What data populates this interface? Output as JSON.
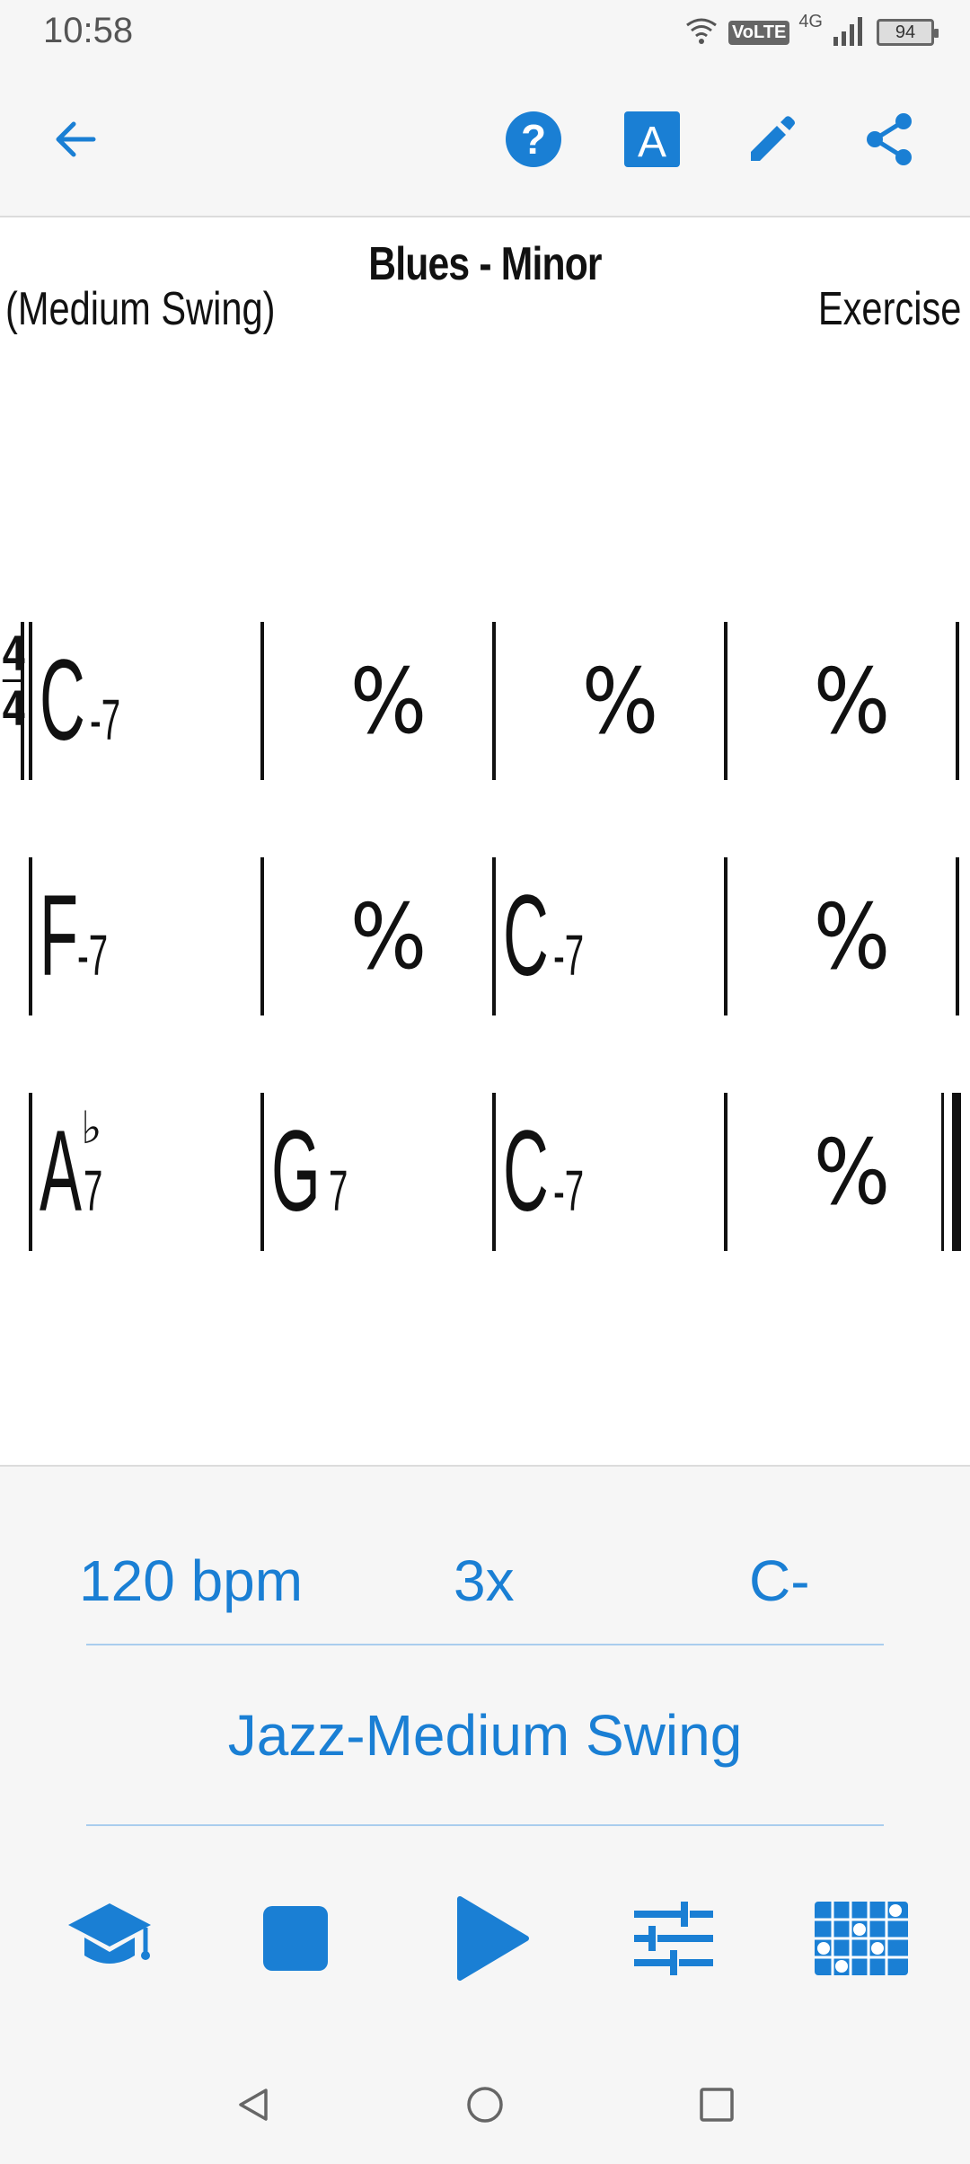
{
  "status_bar": {
    "time": "10:58",
    "network_badge": "VoLTE",
    "network_type": "4G",
    "battery": "94"
  },
  "toolbar": {
    "back_icon": "arrow-left-icon",
    "help_icon": "help-circle-icon",
    "font_icon": "font-a-icon",
    "edit_icon": "pencil-icon",
    "share_icon": "share-icon"
  },
  "sheet": {
    "title": "Blues - Minor",
    "style": "(Medium Swing)",
    "composer": "Exercise",
    "time_signature": {
      "top": "4",
      "bottom": "4"
    },
    "rows": [
      [
        {
          "root": "C",
          "quality": "-7",
          "accidental": ""
        },
        {
          "repeat": "%"
        },
        {
          "repeat": "%"
        },
        {
          "repeat": "%"
        }
      ],
      [
        {
          "root": "F",
          "quality": "-7",
          "accidental": ""
        },
        {
          "repeat": "%"
        },
        {
          "root": "C",
          "quality": "-7",
          "accidental": ""
        },
        {
          "repeat": "%"
        }
      ],
      [
        {
          "root": "A",
          "quality": "7",
          "accidental": "♭"
        },
        {
          "root": "G",
          "quality": "7",
          "accidental": ""
        },
        {
          "root": "C",
          "quality": "-7",
          "accidental": ""
        },
        {
          "repeat": "%"
        }
      ]
    ]
  },
  "player": {
    "tempo": "120 bpm",
    "repeats": "3x",
    "key": "C-",
    "rhythm": "Jazz-Medium Swing",
    "controls": {
      "practice_icon": "graduation-cap-icon",
      "stop_icon": "stop-icon",
      "play_icon": "play-icon",
      "mixer_icon": "sliders-icon",
      "fretboard_icon": "fretboard-grid-icon"
    },
    "accent_color": "#1a7fd4"
  },
  "nav": {
    "back_icon": "nav-back-triangle-icon",
    "home_icon": "nav-home-circle-icon",
    "recents_icon": "nav-recents-square-icon"
  }
}
